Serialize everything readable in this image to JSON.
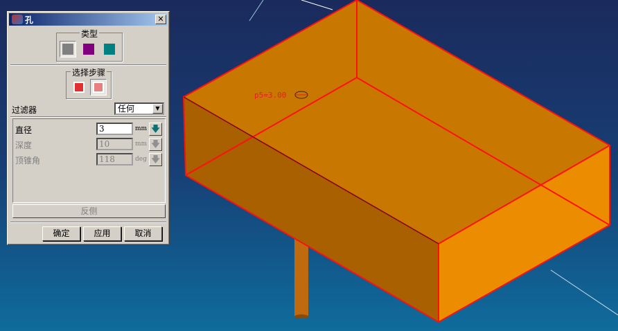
{
  "dialog": {
    "title": "孔",
    "close": "✕",
    "type_group": {
      "label": "类型",
      "options": [
        "simple-hole",
        "counterbore-hole",
        "countersink-hole"
      ]
    },
    "step_group": {
      "label": "选择步骤"
    },
    "filter": {
      "label": "过滤器",
      "value": "任何"
    },
    "params": [
      {
        "label": "直径",
        "value": "3",
        "unit": "mm",
        "enabled": true
      },
      {
        "label": "深度",
        "value": "10",
        "unit": "mm",
        "enabled": false
      },
      {
        "label": "顶锥角",
        "value": "118",
        "unit": "deg",
        "enabled": false
      }
    ],
    "flip_label": "反侧",
    "buttons": {
      "ok": "确定",
      "apply": "应用",
      "cancel": "取消"
    }
  },
  "viewport": {
    "annotation": "p5=3.00",
    "colors": {
      "edge": "#ff1010",
      "top": "#c87800",
      "front": "#a86000",
      "right": "#ec8c00"
    }
  }
}
